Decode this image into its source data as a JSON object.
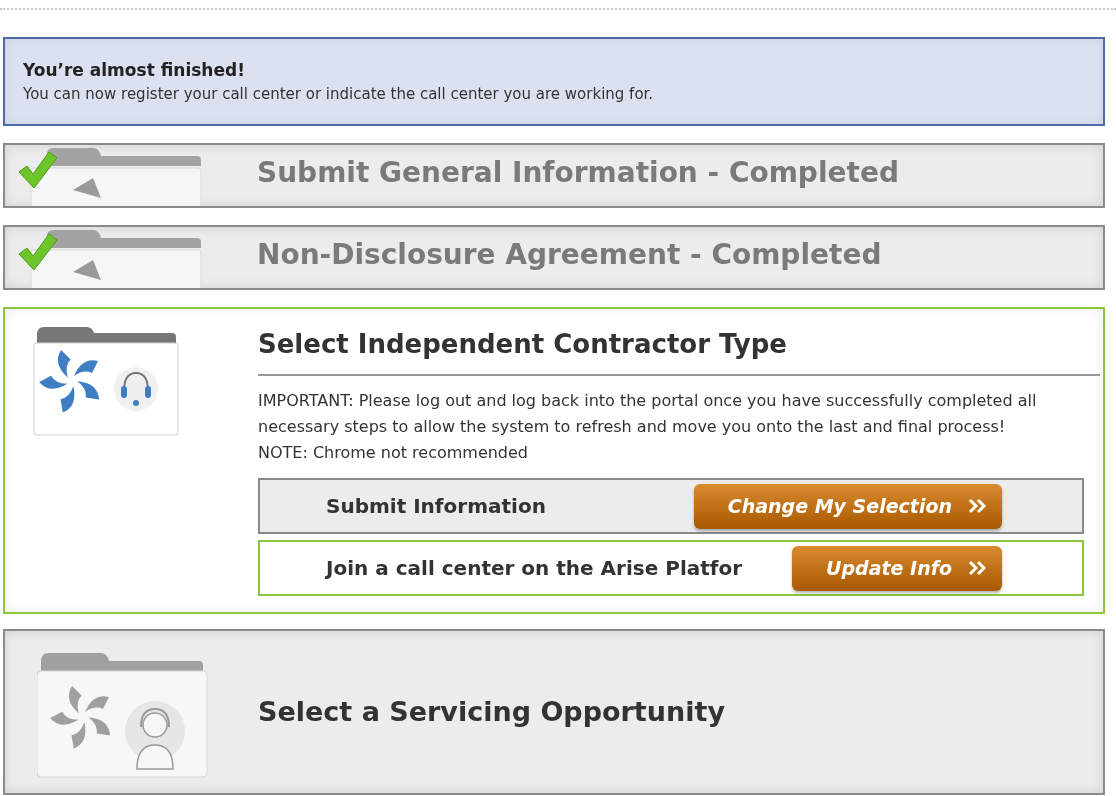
{
  "banner": {
    "title": "You’re almost finished!",
    "message": "You can now register your call center or indicate the call center you are working for."
  },
  "steps": [
    {
      "kind": "completed",
      "title": "Submit General Information - Completed"
    },
    {
      "kind": "completed",
      "title": "Non-Disclosure Agreement - Completed"
    },
    {
      "kind": "active",
      "title": "Select Independent Contractor Type",
      "notice": "IMPORTANT: Please log out and log back into the portal once you have successfully completed all necessary steps to allow the system to refresh and move you onto the last and final process! NOTE: Chrome not recommended",
      "actions": [
        {
          "label": "Submit Information",
          "button": "Change My Selection",
          "highlighted": false
        },
        {
          "label": "Join a call center on the Arise Platfor",
          "button": "Update Info",
          "highlighted": true
        }
      ]
    },
    {
      "kind": "locked",
      "title": "Select a Servicing Opportunity"
    }
  ]
}
